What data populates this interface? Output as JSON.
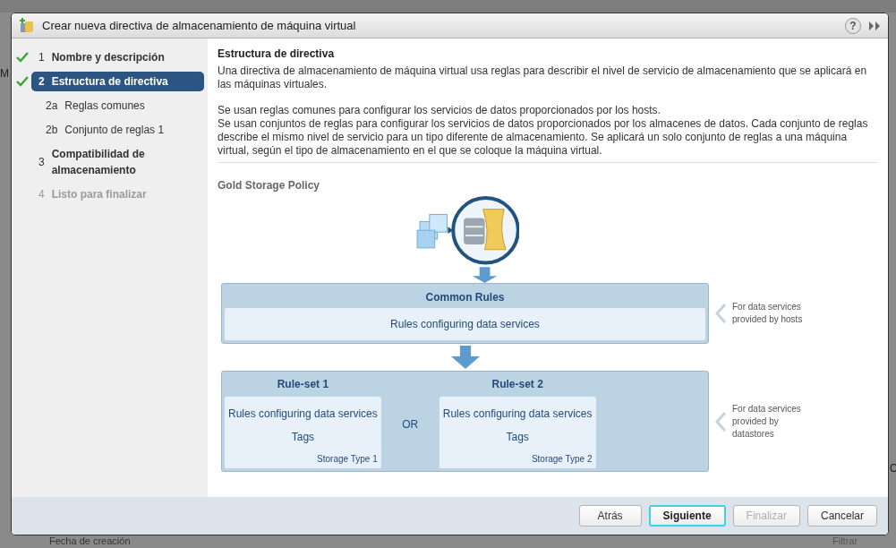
{
  "background": {
    "fragments": [
      "M",
      "Fecha de creación",
      "Filtrar",
      "C"
    ]
  },
  "dialog": {
    "title": "Crear nueva directiva de almacenamiento de máquina virtual",
    "help": "?",
    "steps": [
      {
        "number": "1",
        "label": "Nombre y descripción",
        "done": true,
        "selected": false,
        "disabled": false
      },
      {
        "number": "2",
        "label": "Estructura de directiva",
        "done": true,
        "selected": true,
        "disabled": false,
        "children": [
          {
            "number": "2a",
            "label": "Reglas comunes",
            "selected": false,
            "disabled": false
          },
          {
            "number": "2b",
            "label": "Conjunto de reglas 1",
            "selected": false,
            "disabled": false
          }
        ]
      },
      {
        "number": "3",
        "label": "Compatibilidad de almacenamiento",
        "done": false,
        "selected": false,
        "disabled": false
      },
      {
        "number": "4",
        "label": "Listo para finalizar",
        "done": false,
        "selected": false,
        "disabled": true
      }
    ],
    "content": {
      "heading": "Estructura de directiva",
      "paragraphs": [
        "Una directiva de almacenamiento de máquina virtual usa reglas para describir el nivel de servicio de almacenamiento que se aplicará en las máquinas virtuales.",
        "Se usan reglas comunes para configurar los servicios de datos proporcionados por los hosts.\nSe usan conjuntos de reglas para configurar los servicios de datos proporcionados por los almacenes de datos. Cada conjunto de reglas describe el mismo nivel de servicio para un tipo diferente de almacenamiento. Se aplicará un solo conjunto de reglas a una máquina virtual, según el tipo de almacenamiento en el que se coloque la máquina virtual."
      ],
      "policy_name": "Gold Storage Policy",
      "common_rules": {
        "title": "Common Rules",
        "body": "Rules configuring data services",
        "note": "For data services provided by hosts"
      },
      "rule_sets": [
        {
          "title": "Rule-set 1",
          "lines": [
            "Rules configuring data services",
            "Tags"
          ],
          "storage_type": "Storage Type 1"
        },
        {
          "title": "Rule-set 2",
          "lines": [
            "Rules configuring data services",
            "Tags"
          ],
          "storage_type": "Storage Type 2"
        }
      ],
      "or_label": "OR",
      "rule_sets_note": "For data services provided by datastores"
    },
    "buttons": [
      {
        "label": "Atrás",
        "focused": false,
        "disabled": false
      },
      {
        "label": "Siguiente",
        "focused": true,
        "disabled": false
      },
      {
        "label": "Finalizar",
        "focused": false,
        "disabled": true
      },
      {
        "label": "Cancelar",
        "focused": false,
        "disabled": false
      }
    ]
  }
}
